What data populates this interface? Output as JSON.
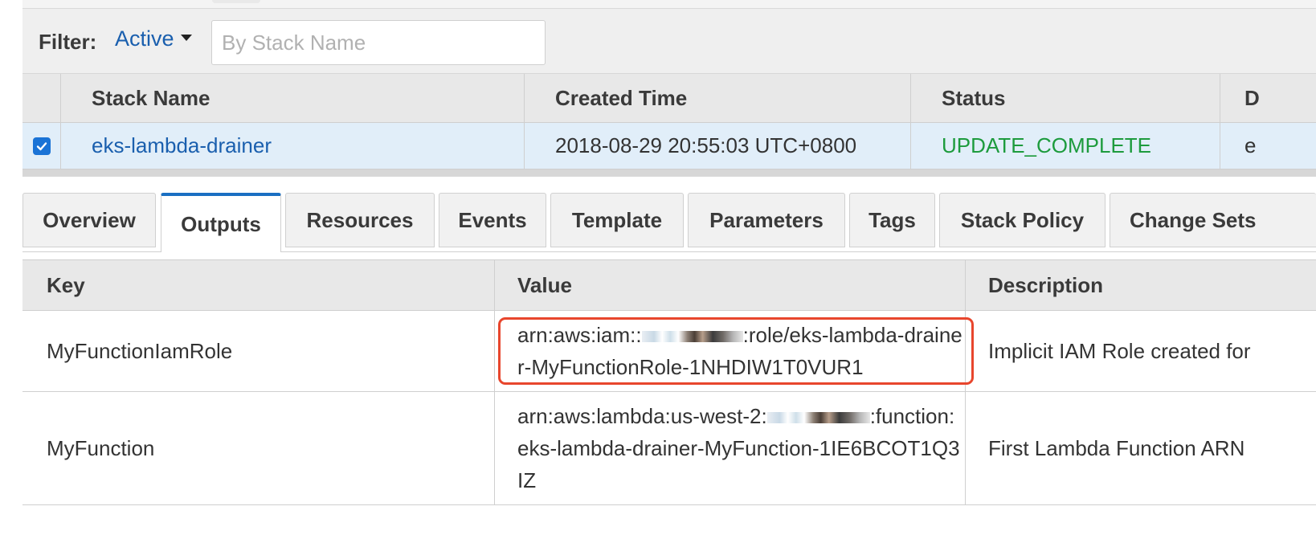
{
  "filter": {
    "label": "Filter:",
    "dropdown_value": "Active",
    "search_placeholder": "By Stack Name",
    "search_value": ""
  },
  "stacks_table": {
    "columns": [
      "Stack Name",
      "Created Time",
      "Status",
      "D"
    ],
    "rows": [
      {
        "selected": true,
        "stack_name": "eks-lambda-drainer",
        "created_time": "2018-08-29 20:55:03 UTC+0800",
        "status": "UPDATE_COMPLETE",
        "description": "e"
      }
    ]
  },
  "tabs": [
    {
      "label": "Overview",
      "active": false
    },
    {
      "label": "Outputs",
      "active": true
    },
    {
      "label": "Resources",
      "active": false
    },
    {
      "label": "Events",
      "active": false
    },
    {
      "label": "Template",
      "active": false
    },
    {
      "label": "Parameters",
      "active": false
    },
    {
      "label": "Tags",
      "active": false
    },
    {
      "label": "Stack Policy",
      "active": false
    },
    {
      "label": "Change Sets",
      "active": false
    }
  ],
  "outputs_table": {
    "columns": [
      "Key",
      "Value",
      "Description"
    ],
    "rows": [
      {
        "key": "MyFunctionIamRole",
        "value_prefix": "arn:aws:iam::",
        "value_suffix": ":role/eks-lambda-drainer-MyFunctionRole-1NHDIW1T0VUR1",
        "description": "Implicit IAM Role created for"
      },
      {
        "key": "MyFunction",
        "value_prefix": "arn:aws:lambda:us-west-2:",
        "value_suffix": ":function:eks-lambda-drainer-MyFunction-1IE6BCOT1Q3IZ",
        "description": "First Lambda Function ARN"
      }
    ]
  },
  "colors": {
    "link": "#1a5fae",
    "status_ok": "#1d9b3d",
    "selected_row": "#e1eef9",
    "active_tab_border": "#1a6fc2",
    "highlight": "#e8462d"
  }
}
